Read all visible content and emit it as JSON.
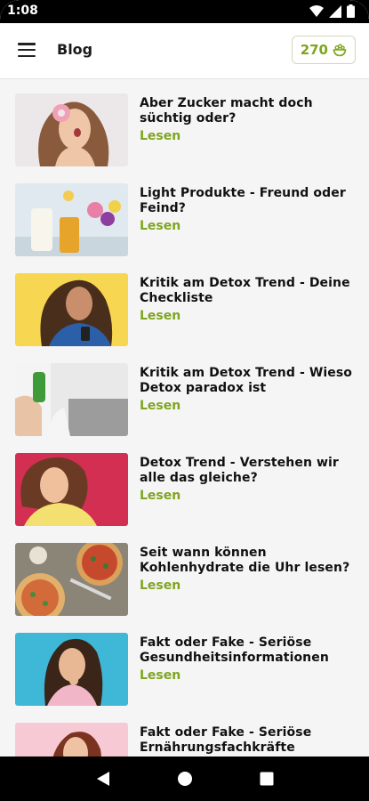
{
  "status_bar": {
    "time": "1:08"
  },
  "app_bar": {
    "title": "Blog",
    "points": "270"
  },
  "read_label": "Lesen",
  "posts": [
    {
      "title": "Aber Zucker macht doch süchtig oder?"
    },
    {
      "title": "Light Produkte - Freund oder Feind?"
    },
    {
      "title": "Kritik am Detox Trend - Deine Checkliste"
    },
    {
      "title": "Kritik am Detox Trend - Wieso Detox paradox ist"
    },
    {
      "title": "Detox Trend - Verstehen wir alle das gleiche?"
    },
    {
      "title": "Seit wann können Kohlenhydrate die Uhr lesen?"
    },
    {
      "title": "Fakt oder Fake - Seriöse Gesundheitsinformationen"
    },
    {
      "title": "Fakt oder Fake - Seriöse Ernährungsfachkräfte"
    }
  ],
  "colors": {
    "accent": "#7ea51e",
    "background": "#f5f5f5"
  },
  "icons": {
    "menu": "hamburger-icon",
    "points": "bowl-icon",
    "nav_back": "back-triangle-icon",
    "nav_home": "home-circle-icon",
    "nav_recents": "recents-square-icon"
  }
}
